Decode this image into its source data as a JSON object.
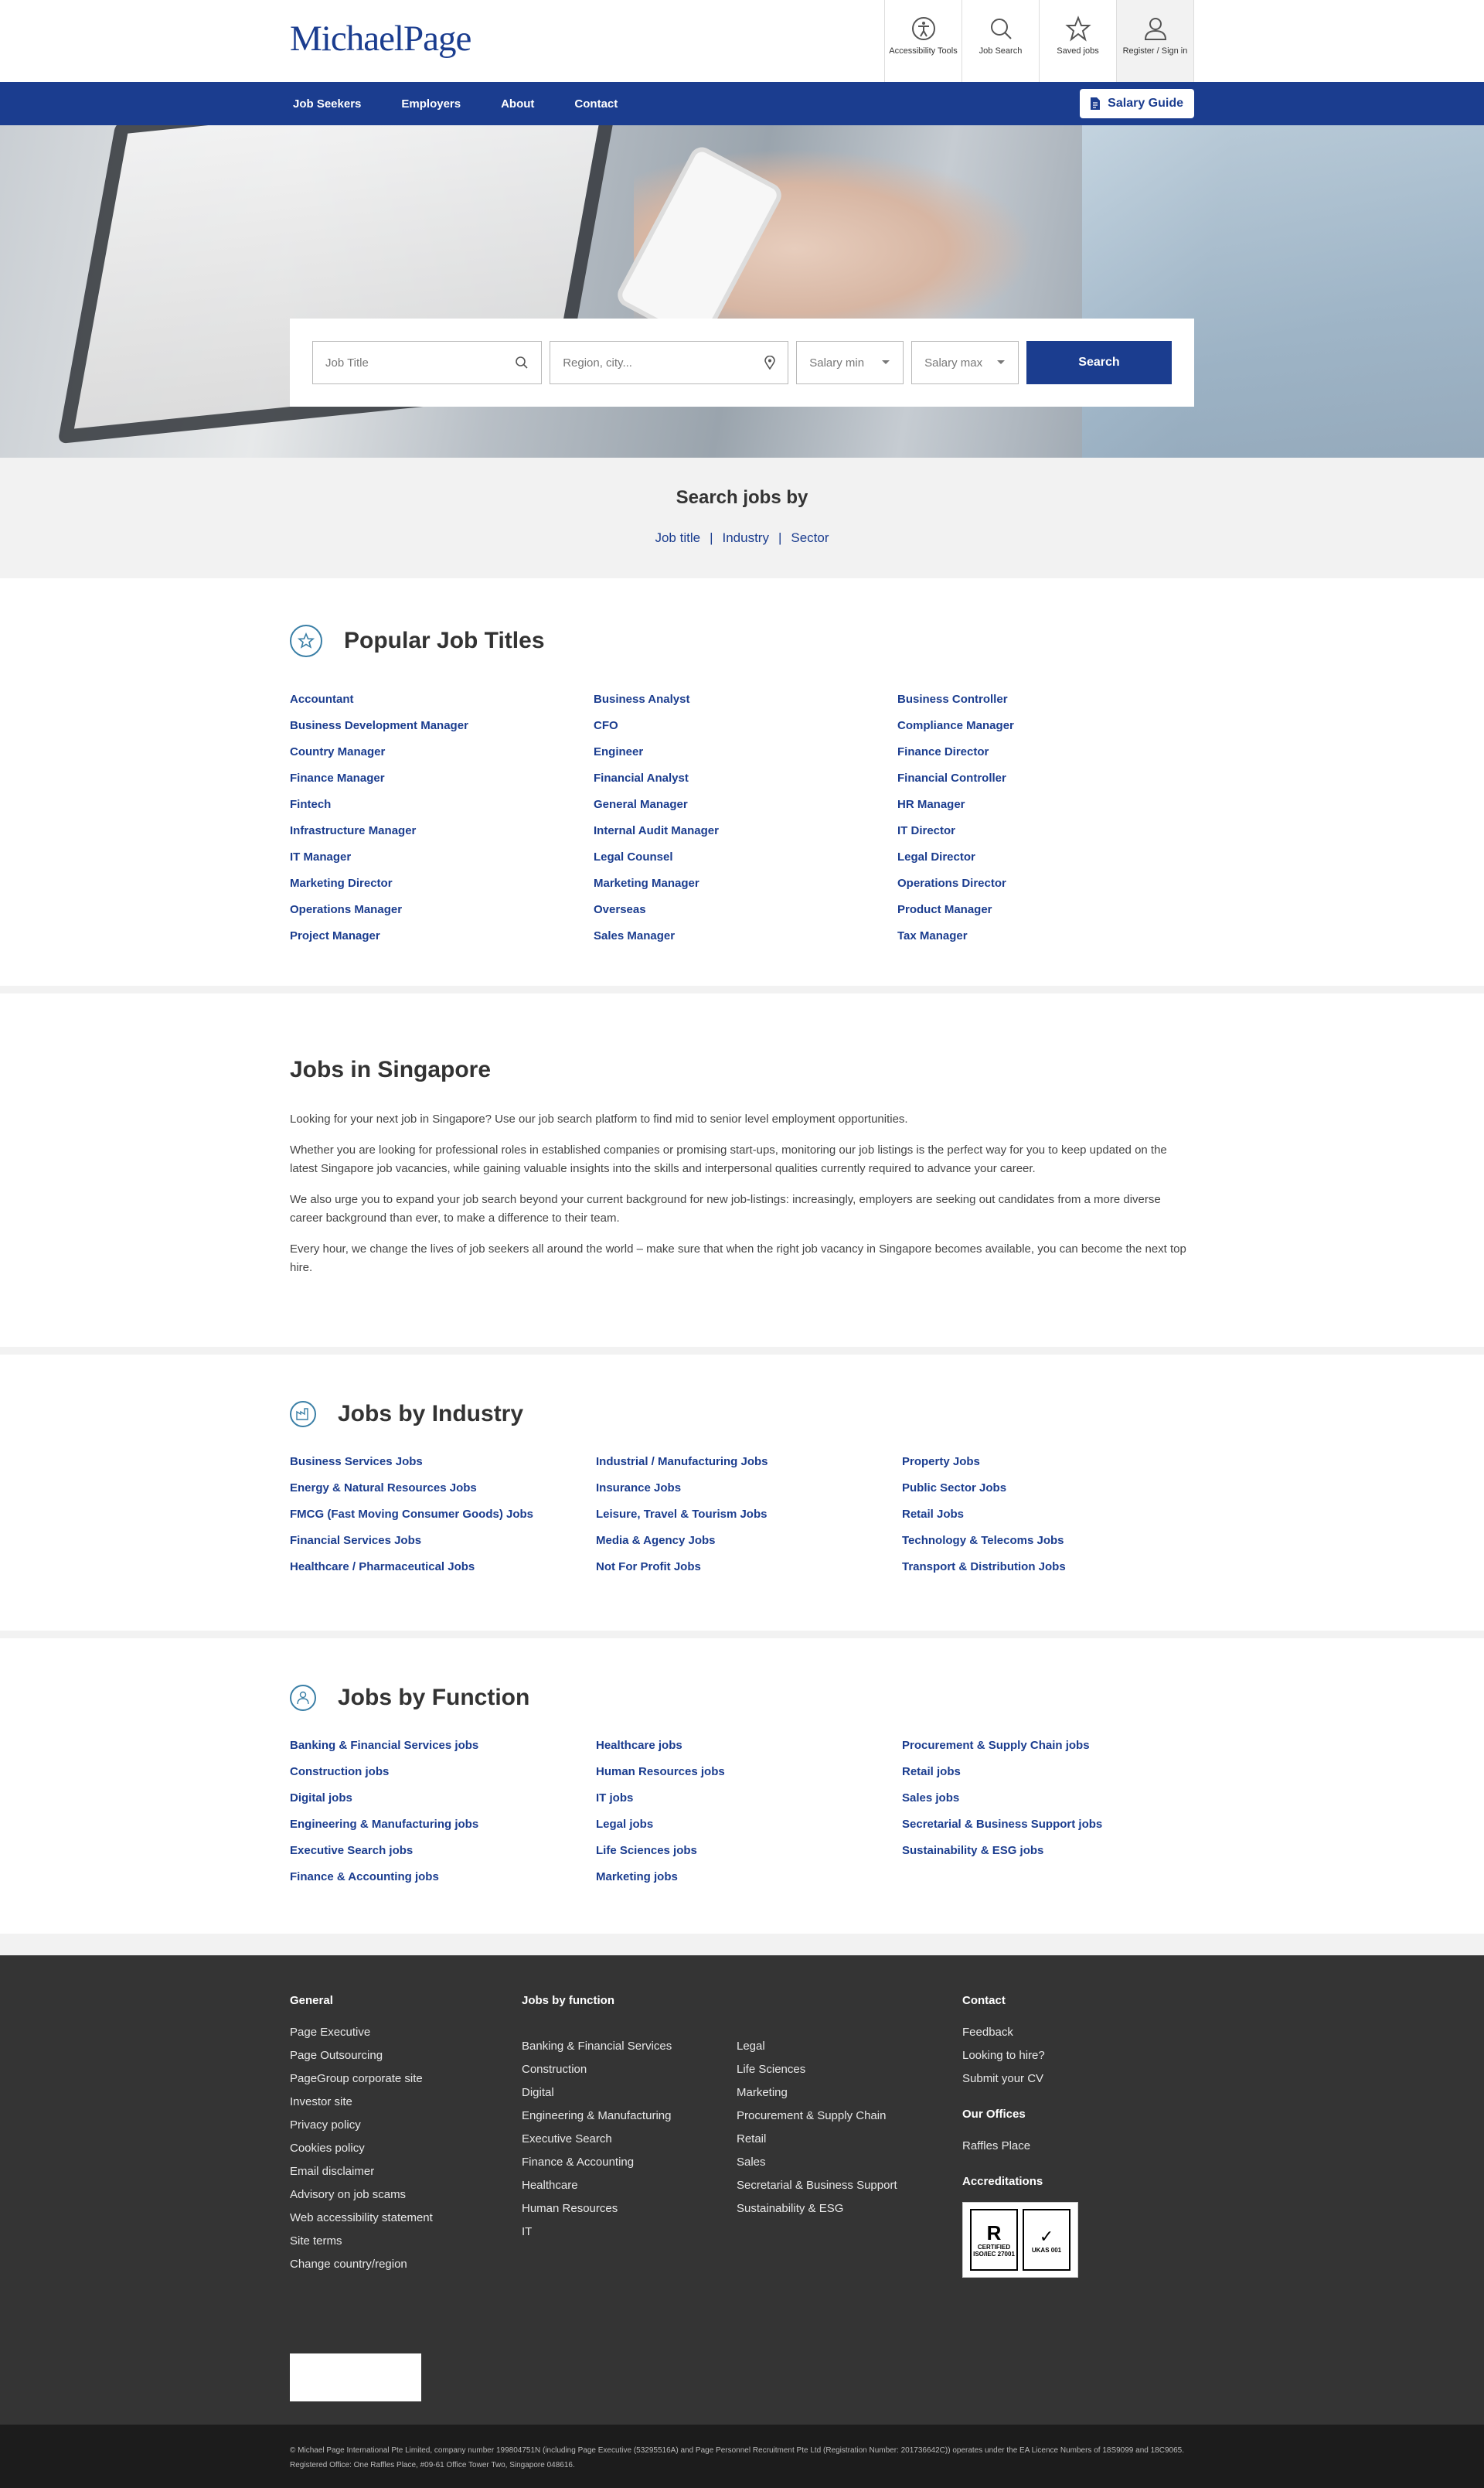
{
  "brand": {
    "logo_part1": "Michael",
    "logo_part2": "Page"
  },
  "tools": [
    {
      "label": "Accessibility Tools",
      "icon": "accessibility-icon"
    },
    {
      "label": "Job Search",
      "icon": "search-icon"
    },
    {
      "label": "Saved jobs",
      "icon": "star-icon"
    },
    {
      "label": "Register / Sign in",
      "icon": "user-icon"
    }
  ],
  "nav": {
    "items": [
      "Job Seekers",
      "Employers",
      "About",
      "Contact"
    ],
    "salary_guide": "Salary Guide"
  },
  "search": {
    "job_title_placeholder": "Job Title",
    "region_placeholder": "Region, city...",
    "salary_min": "Salary min",
    "salary_max": "Salary max",
    "button": "Search"
  },
  "search_by": {
    "title": "Search jobs by",
    "links": [
      "Job title",
      "Industry",
      "Sector"
    ]
  },
  "popular": {
    "title": "Popular Job Titles",
    "col1": [
      "Accountant",
      "Business Development Manager",
      "Country Manager",
      "Finance Manager",
      "Fintech",
      "Infrastructure Manager",
      "IT Manager",
      "Marketing Director",
      "Operations Manager",
      "Project Manager"
    ],
    "col2": [
      "Business Analyst",
      "CFO",
      "Engineer",
      "Financial Analyst",
      "General Manager",
      "Internal Audit Manager",
      "Legal Counsel",
      "Marketing Manager",
      "Overseas",
      "Sales Manager"
    ],
    "col3": [
      "Business Controller",
      "Compliance Manager",
      "Finance Director",
      "Financial Controller",
      "HR Manager",
      "IT Director",
      "Legal Director",
      "Operations Director",
      "Product Manager",
      "Tax Manager"
    ]
  },
  "singapore": {
    "title": "Jobs in Singapore",
    "p1": "Looking for your next job in Singapore? Use our job search platform to find mid to senior level employment opportunities.",
    "p2": "Whether you are looking for professional roles in established companies or promising start-ups, monitoring our job listings is the perfect way for you to keep updated on the latest Singapore job vacancies, while gaining valuable insights into the skills and interpersonal qualities currently required to advance your career.",
    "p3": "We also urge you to expand your job search beyond your current background for new job-listings: increasingly, employers are seeking out candidates from a more diverse career background than ever, to make a difference to their team.",
    "p4": "Every hour, we change the lives of job seekers all around the world – make sure that when the right job vacancy in Singapore becomes available, you can become the next top hire."
  },
  "industry": {
    "title": "Jobs by Industry",
    "col1": [
      "Business Services Jobs",
      "Energy & Natural Resources Jobs",
      "FMCG (Fast Moving Consumer Goods) Jobs",
      "Financial Services Jobs",
      "Healthcare / Pharmaceutical Jobs"
    ],
    "col2": [
      "Industrial / Manufacturing Jobs",
      "Insurance Jobs",
      "Leisure, Travel & Tourism Jobs",
      "Media & Agency Jobs",
      "Not For Profit Jobs"
    ],
    "col3": [
      "Property Jobs",
      "Public Sector Jobs",
      "Retail Jobs",
      "Technology & Telecoms Jobs",
      "Transport & Distribution Jobs"
    ]
  },
  "function": {
    "title": "Jobs by Function",
    "col1": [
      "Banking & Financial Services jobs",
      "Construction jobs",
      "Digital jobs",
      "Engineering & Manufacturing jobs",
      "Executive Search jobs",
      "Finance & Accounting jobs"
    ],
    "col2": [
      "Healthcare jobs",
      "Human Resources jobs",
      "IT jobs",
      "Legal jobs",
      "Life Sciences jobs",
      "Marketing jobs"
    ],
    "col3": [
      "Procurement & Supply Chain jobs",
      "Retail jobs",
      "Sales jobs",
      "Secretarial & Business Support jobs",
      "Sustainability & ESG jobs"
    ]
  },
  "footer": {
    "general_title": "General",
    "general": [
      "Page Executive",
      "Page Outsourcing",
      "PageGroup corporate site",
      "Investor site",
      "Privacy policy",
      "Cookies policy",
      "Email disclaimer",
      "Advisory on job scams",
      "Web accessibility statement",
      "Site terms",
      "Change country/region"
    ],
    "jobs_title": "Jobs by function",
    "jobs_col1": [
      "Banking & Financial Services",
      "Construction",
      "Digital",
      "Engineering & Manufacturing",
      "Executive Search",
      "Finance & Accounting",
      "Healthcare",
      "Human Resources",
      "IT"
    ],
    "jobs_col2": [
      "Legal",
      "Life Sciences",
      "Marketing",
      "Procurement & Supply Chain",
      "Retail",
      "Sales",
      "Secretarial & Business Support",
      "Sustainability & ESG"
    ],
    "contact_title": "Contact",
    "contact": [
      "Feedback",
      "Looking to hire?",
      "Submit your CV"
    ],
    "offices_title": "Our Offices",
    "offices": [
      "Raffles Place"
    ],
    "accred_title": "Accreditations",
    "accred_left": "CERTIFIED ISO/IEC 27001",
    "accred_right": "UKAS 001",
    "legal": "© Michael Page International Pte Limited, company number 199804751N (including Page Executive (53295516A) and Page Personnel Recruitment Pte Ltd (Registration Number: 201736642C)) operates under the EA Licence Numbers of 18S9099 and 18C9065. Registered Office: One Raffles Place, #09-61 Office Tower Two, Singapore 048616."
  }
}
